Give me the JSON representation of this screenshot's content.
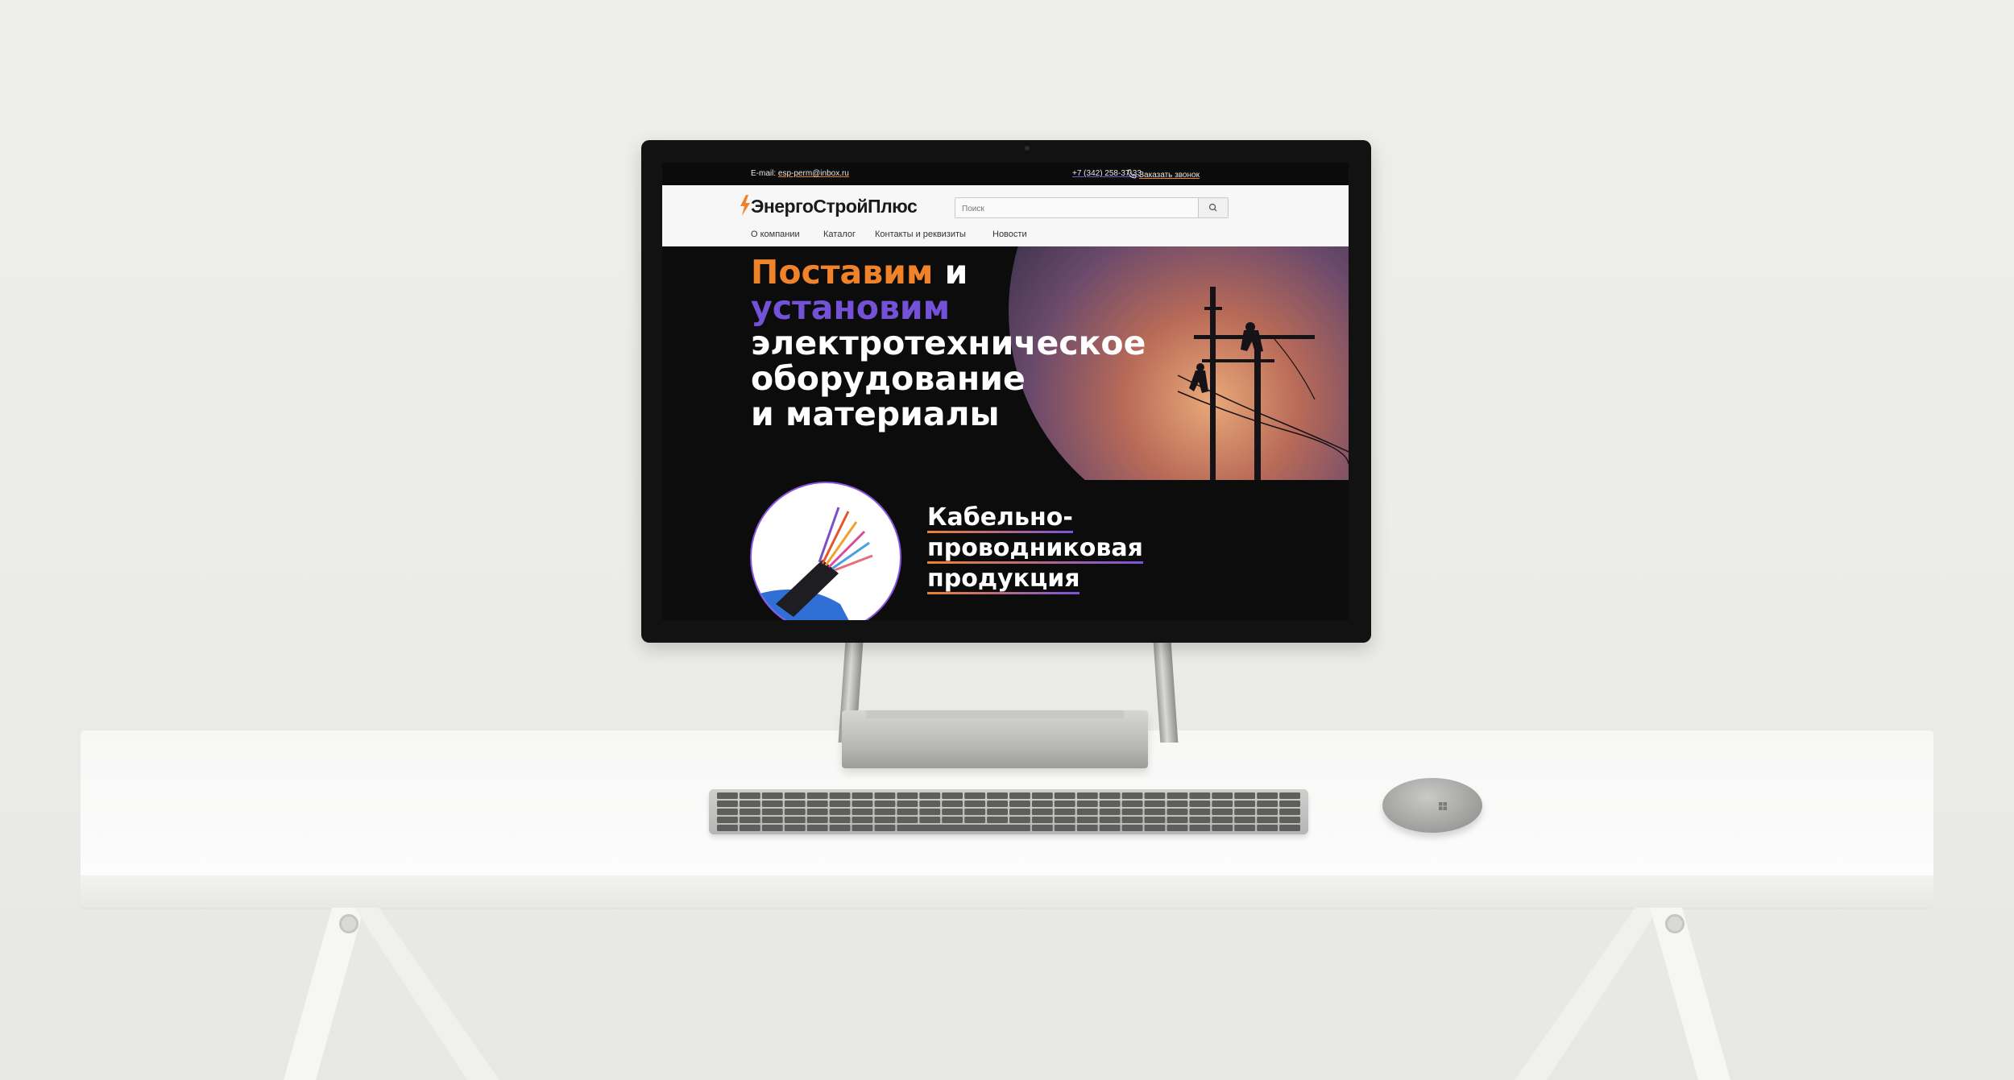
{
  "topbar": {
    "email_label": "E-mail:",
    "email_value": "esp-perm@inbox.ru",
    "phone": "+7 (342) 258-37-33",
    "callback_label": "Заказать звонок"
  },
  "header": {
    "logo_text": "ЭнергоСтройПлюс",
    "search_placeholder": "Поиск",
    "nav": [
      {
        "label": "О компании"
      },
      {
        "label": "Каталог"
      },
      {
        "label": "Контакты и реквизиты"
      },
      {
        "label": "Новости"
      }
    ]
  },
  "hero": {
    "line1_word": "Поставим",
    "line1_rest": " и",
    "line2": "установим",
    "line3": "электротехническое",
    "line4": "оборудование",
    "line5": "и материалы"
  },
  "product": {
    "title_line1": "Кабельно-",
    "title_line2": "проводниковая",
    "title_line3": "продукция"
  },
  "colors": {
    "accent_orange": "#f0822a",
    "accent_purple": "#7352d8",
    "hero_background": "#0c0c0c",
    "header_background": "#f7f7f7"
  },
  "icons": [
    "lightning-logo-icon",
    "search-icon",
    "phone-icon",
    "microsoft-logo-icon"
  ]
}
